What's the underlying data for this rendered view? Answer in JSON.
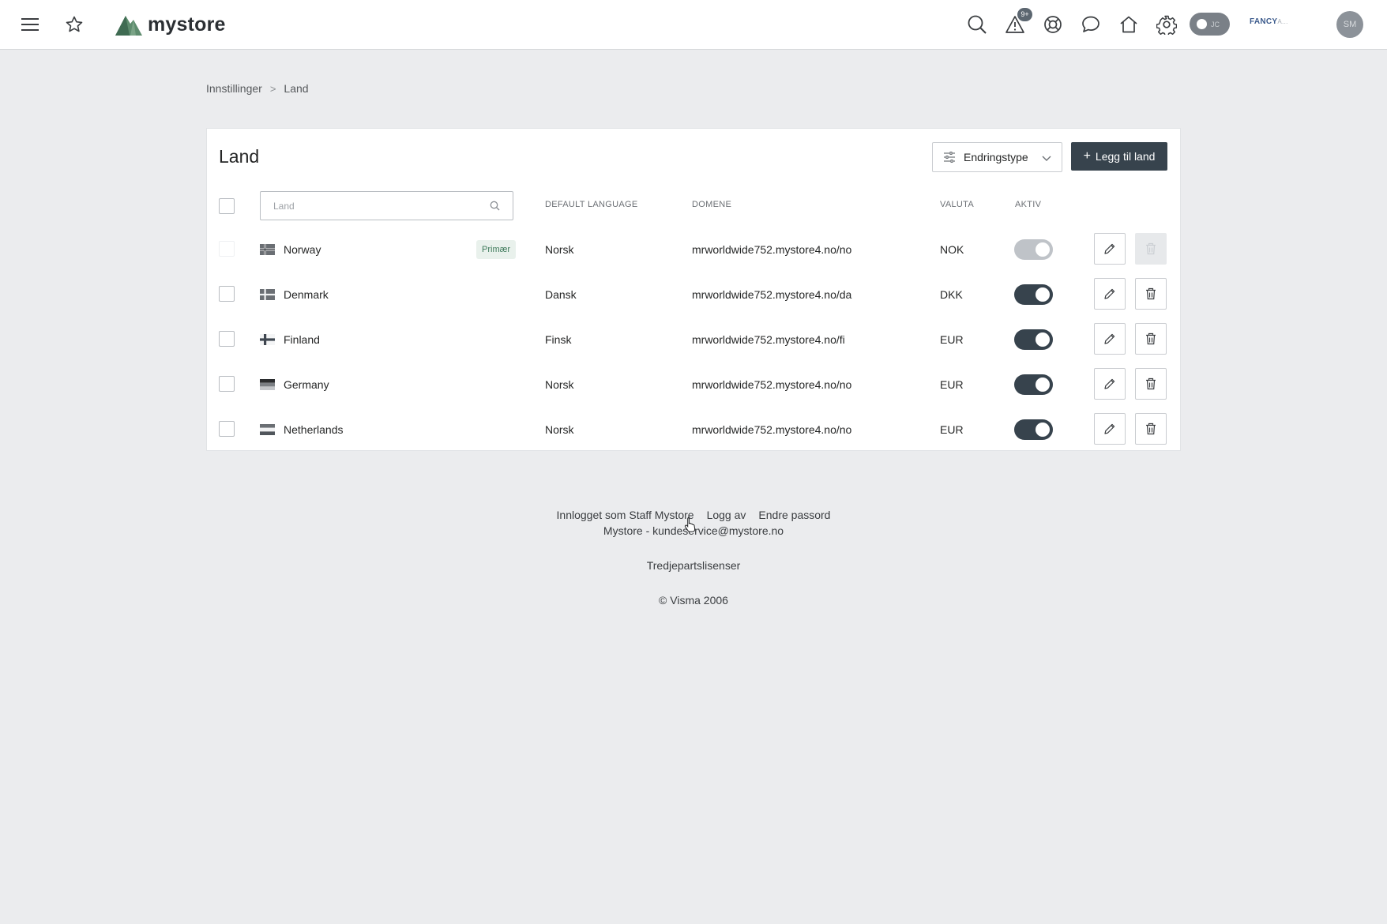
{
  "app": {
    "logo_text": "mystore",
    "notification_count": "9+",
    "toggle_pill_text": "JC",
    "company_name": "FANCY",
    "company_sub": "A...",
    "avatar_initials": "SM"
  },
  "breadcrumb": {
    "parent": "Innstillinger",
    "separator": ">",
    "current": "Land"
  },
  "card": {
    "title": "Land",
    "filter_label": "Endringstype",
    "add_label": "Legg til land",
    "add_plus": "+",
    "search_placeholder": "Land",
    "headers": {
      "language": "DEFAULT LANGUAGE",
      "domain": "DOMENE",
      "currency": "VALUTA",
      "active": "AKTIV"
    },
    "primary_badge": "Primær",
    "rows": [
      {
        "country": "Norway",
        "language": "Norsk",
        "domain": "mrworldwide752.mystore4.no/no",
        "currency": "NOK",
        "active": true,
        "primary": true
      },
      {
        "country": "Denmark",
        "language": "Dansk",
        "domain": "mrworldwide752.mystore4.no/da",
        "currency": "DKK",
        "active": true,
        "primary": false
      },
      {
        "country": "Finland",
        "language": "Finsk",
        "domain": "mrworldwide752.mystore4.no/fi",
        "currency": "EUR",
        "active": true,
        "primary": false
      },
      {
        "country": "Germany",
        "language": "Norsk",
        "domain": "mrworldwide752.mystore4.no/no",
        "currency": "EUR",
        "active": true,
        "primary": false
      },
      {
        "country": "Netherlands",
        "language": "Norsk",
        "domain": "mrworldwide752.mystore4.no/no",
        "currency": "EUR",
        "active": true,
        "primary": false
      }
    ]
  },
  "footer": {
    "logged_in": "Innlogget som Staff Mystore",
    "logout": "Logg av",
    "change_password": "Endre passord",
    "contact": "Mystore - kundeservice@mystore.no",
    "licenses": "Tredjepartslisenser",
    "copyright": "© Visma 2006"
  },
  "colors": {
    "primary": "#37434d",
    "background": "#ebecee",
    "badge_bg": "#e9f1ec",
    "badge_text": "#3e7a5a"
  },
  "icons": [
    "menu-icon",
    "star-icon",
    "search-icon",
    "warning-icon",
    "help-icon",
    "chat-icon",
    "home-icon",
    "gear-icon",
    "filter-icon",
    "chevron-down-icon",
    "pencil-icon",
    "trash-icon"
  ]
}
